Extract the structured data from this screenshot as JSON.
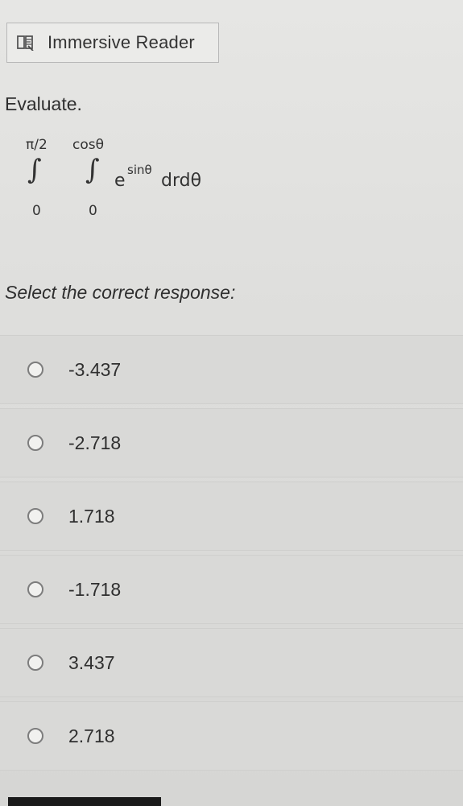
{
  "toolbar": {
    "immersive_reader_label": "Immersive Reader",
    "icon": "immersive-reader-icon"
  },
  "question": {
    "instruction": "Evaluate.",
    "formula": {
      "outer_upper": "π/2",
      "outer_lower": "0",
      "inner_upper": "cosθ",
      "inner_lower": "0",
      "base": "e",
      "exponent": "sinθ",
      "differentials": "drdθ"
    },
    "prompt": "Select the correct response:"
  },
  "options": [
    {
      "label": "-3.437"
    },
    {
      "label": "-2.718"
    },
    {
      "label": "1.718"
    },
    {
      "label": "-1.718"
    },
    {
      "label": "3.437"
    },
    {
      "label": "2.718"
    }
  ]
}
